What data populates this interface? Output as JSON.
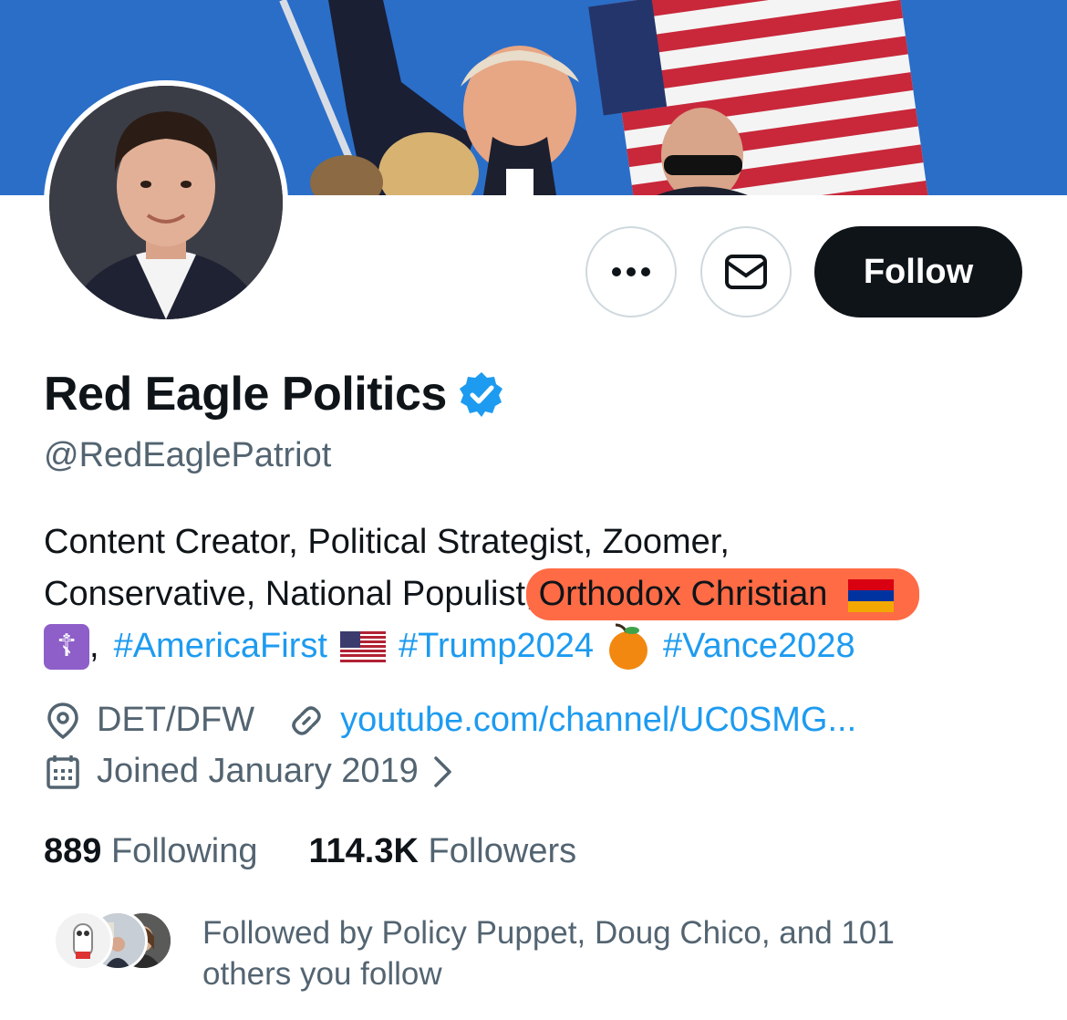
{
  "profile": {
    "name": "Red Eagle Politics",
    "handle": "@RedEaglePatriot",
    "follow_label": "Follow",
    "more_label": "•••"
  },
  "bio": {
    "line1": "Content Creator, Political Strategist, Zoomer,",
    "line2_prefix": "Conservative, National Populist,",
    "line2_highlight": "Orthodox Christian",
    "line3_sep": ",",
    "tag1": "#AmericaFirst",
    "tag2": "#Trump2024",
    "tag3": "#Vance2028",
    "cross_glyph": "☦"
  },
  "meta": {
    "location": "DET/DFW",
    "url": "youtube.com/channel/UC0SMG...",
    "joined": "Joined January 2019"
  },
  "stats": {
    "following_count": "889",
    "following_label": "Following",
    "followers_count": "114.3K",
    "followers_label": "Followers"
  },
  "followed_by": {
    "line1": "Followed by Policy Puppet, Doug Chico, and 101",
    "line2": "others you follow"
  },
  "colors": {
    "accent": "#1d9bf0",
    "highlight": "#ff6b45",
    "text": "#0f1419",
    "muted": "#536471"
  },
  "icons": [
    "more-icon",
    "mail-icon",
    "verified-badge-icon",
    "location-icon",
    "link-icon",
    "calendar-icon",
    "chevron-right-icon"
  ]
}
